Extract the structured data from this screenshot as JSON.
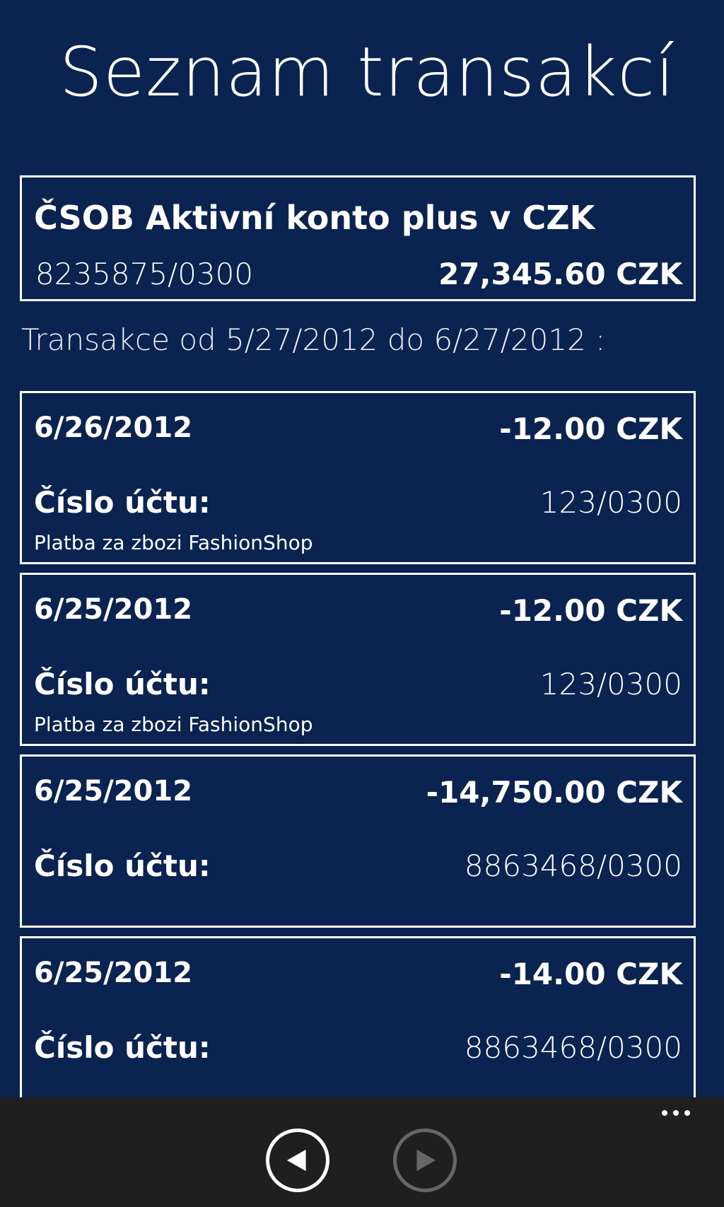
{
  "header": {
    "title": "Seznam transakcí"
  },
  "account": {
    "name": "ČSOB Aktivní konto plus v CZK",
    "number": "8235875/0300",
    "balance": "27,345.60 CZK"
  },
  "range_label": "Transakce od 5/27/2012 do 6/27/2012 :",
  "transactions": [
    {
      "date": "6/26/2012",
      "amount": "-12.00 CZK",
      "account_label": "Číslo účtu:",
      "account_value": "123/0300",
      "note": "Platba za zbozi FashionShop"
    },
    {
      "date": "6/25/2012",
      "amount": "-12.00 CZK",
      "account_label": "Číslo účtu:",
      "account_value": "123/0300",
      "note": "Platba za zbozi FashionShop"
    },
    {
      "date": "6/25/2012",
      "amount": "-14,750.00 CZK",
      "account_label": "Číslo účtu:",
      "account_value": "8863468/0300",
      "note": ""
    },
    {
      "date": "6/25/2012",
      "amount": "-14.00 CZK",
      "account_label": "Číslo účtu:",
      "account_value": "8863468/0300",
      "note": ""
    }
  ],
  "app_bar": {
    "prev_icon": "arrow-left-icon",
    "next_icon": "arrow-right-icon",
    "more_icon": "more-dots-icon",
    "next_enabled": false
  },
  "colors": {
    "background": "#0a2350",
    "app_bar": "#1f1f1f",
    "text": "#ffffff",
    "disabled": "#666666"
  }
}
